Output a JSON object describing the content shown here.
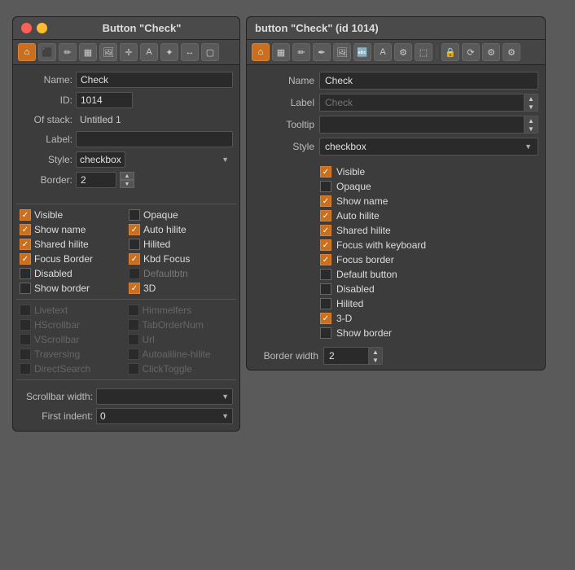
{
  "left_panel": {
    "title": "Button \"Check\"",
    "toolbar": {
      "icons": [
        "🏠",
        "⬛",
        "✏️",
        "🖼",
        "🖼",
        "✛",
        "A",
        "✦",
        "↔",
        "🔲"
      ]
    },
    "fields": {
      "name_label": "Name:",
      "name_value": "Check",
      "id_label": "ID:",
      "id_value": "1014",
      "ofstack_label": "Of stack:",
      "ofstack_value": "Untitled 1",
      "label_label": "Label:",
      "label_value": "",
      "style_label": "Style:",
      "style_value": "checkbox",
      "border_label": "Border:",
      "border_value": "2"
    },
    "checkboxes_col1": [
      {
        "id": "visible",
        "label": "Visible",
        "checked": true,
        "disabled": false
      },
      {
        "id": "show-name",
        "label": "Show name",
        "checked": true,
        "disabled": false
      },
      {
        "id": "shared-hilite",
        "label": "Shared hilite",
        "checked": true,
        "disabled": false
      },
      {
        "id": "focus-border",
        "label": "Focus Border",
        "checked": true,
        "disabled": false
      },
      {
        "id": "disabled",
        "label": "Disabled",
        "checked": false,
        "disabled": false
      },
      {
        "id": "show-border",
        "label": "Show border",
        "checked": false,
        "disabled": false
      }
    ],
    "checkboxes_col2": [
      {
        "id": "opaque",
        "label": "Opaque",
        "checked": false,
        "disabled": false
      },
      {
        "id": "auto-hilite",
        "label": "Auto hilite",
        "checked": true,
        "disabled": false
      },
      {
        "id": "hilited",
        "label": "Hilited",
        "checked": false,
        "disabled": false
      },
      {
        "id": "kbd-focus",
        "label": "Kbd Focus",
        "checked": true,
        "disabled": false
      },
      {
        "id": "defaultbutton-l",
        "label": "Defaultbtn",
        "checked": false,
        "disabled": true
      },
      {
        "id": "three-d",
        "label": "3D",
        "checked": true,
        "disabled": false
      }
    ],
    "greyed_rows": [
      [
        "Livetext",
        "Himmelfers"
      ],
      [
        "HScrollbar",
        "TabOrderNum"
      ],
      [
        "VScrollbar",
        "Url"
      ],
      [
        "Traversing",
        "Autoaliline-hilite"
      ],
      [
        "DirectSearch",
        "ClickToggle"
      ]
    ],
    "bottom": {
      "scrollbar_label": "Scrollbar width:",
      "scrollbar_value": "",
      "firstindent_label": "First indent:",
      "firstindent_value": "0"
    }
  },
  "right_panel": {
    "title": "button \"Check\" (id 1014)",
    "toolbar_icons": [
      "🏠",
      "▦",
      "✏️",
      "🖋",
      "🖼",
      "🔤",
      "A",
      "⚙",
      "⬚",
      "🔒",
      "⟳",
      "⚙",
      "⚙"
    ],
    "fields": {
      "name_label": "Name",
      "name_value": "Check",
      "label_label": "Label",
      "label_placeholder": "Check",
      "tooltip_label": "Tooltip",
      "tooltip_value": "",
      "style_label": "Style",
      "style_value": "checkbox"
    },
    "checkboxes": [
      {
        "id": "visible",
        "label": "Visible",
        "checked": true,
        "dimmed": false
      },
      {
        "id": "opaque",
        "label": "Opaque",
        "checked": false,
        "dimmed": false
      },
      {
        "id": "show-name",
        "label": "Show name",
        "checked": true,
        "dimmed": false
      },
      {
        "id": "auto-hilite",
        "label": "Auto hilite",
        "checked": true,
        "dimmed": false
      },
      {
        "id": "shared-hilite",
        "label": "Shared hilite",
        "checked": true,
        "dimmed": false
      },
      {
        "id": "focus-keyboard",
        "label": "Focus with keyboard",
        "checked": true,
        "dimmed": false
      },
      {
        "id": "focus-border",
        "label": "Focus border",
        "checked": true,
        "dimmed": false
      },
      {
        "id": "default-button",
        "label": "Default button",
        "checked": false,
        "dimmed": false
      },
      {
        "id": "disabled",
        "label": "Disabled",
        "checked": false,
        "dimmed": false
      },
      {
        "id": "hilited",
        "label": "Hilited",
        "checked": false,
        "dimmed": false
      },
      {
        "id": "three-d",
        "label": "3-D",
        "checked": true,
        "dimmed": false
      },
      {
        "id": "show-border",
        "label": "Show border",
        "checked": false,
        "dimmed": false
      }
    ],
    "border_width_label": "Border width",
    "border_width_value": "2"
  }
}
